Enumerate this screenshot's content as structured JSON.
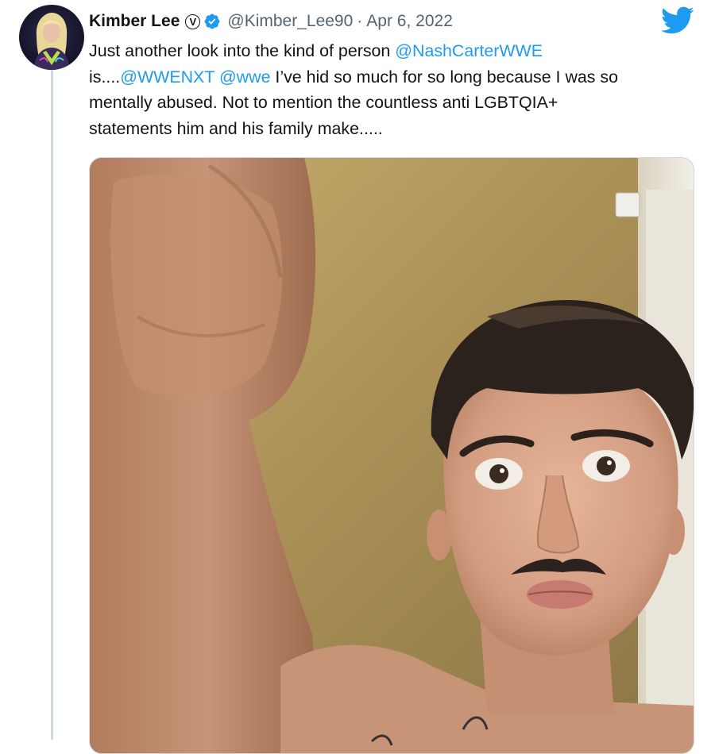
{
  "tweet": {
    "display_name": "Kimber Lee",
    "badge_letter": "V",
    "handle": "@Kimber_Lee90",
    "separator": "·",
    "date": "Apr 6, 2022",
    "text": {
      "l1_text": "Just another look into the kind of person ",
      "l1_mention": "@NashCarterWWE",
      "l2_pre": "is....",
      "l2_mention1": "@WWENXT",
      "l2_space": " ",
      "l2_mention2": "@wwe",
      "l2_post": " I’ve hid so much for so long because I was so",
      "l3": "mentally abused. Not to mention the countless anti LGBTQIA+",
      "l4": "statements him and his family make....."
    }
  },
  "colors": {
    "link": "#1d9bf0",
    "twitter_blue": "#1d9bf0",
    "verified": "#1d9bf0",
    "secondary_text": "#536471"
  },
  "icons": {
    "verified": "verified-badge-icon",
    "brand": "twitter-bird-icon",
    "label": "circled-v-icon"
  }
}
